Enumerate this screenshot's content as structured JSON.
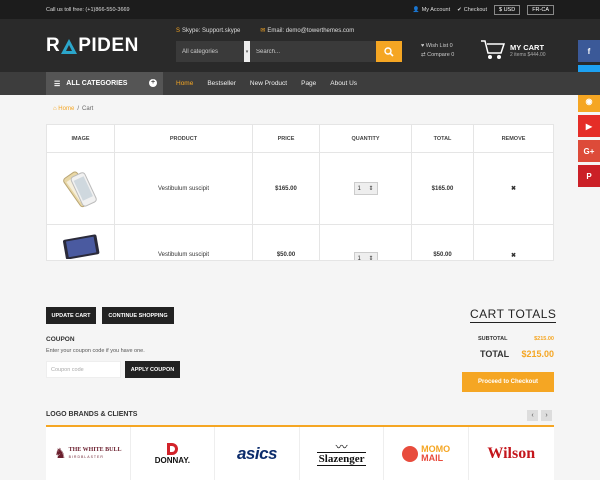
{
  "topbar": {
    "call": "Call us toll free: (+1)866-550-3669",
    "my_account": "My Account",
    "checkout": "Checkout",
    "currency": "$ USD",
    "language": "FR-CA"
  },
  "header": {
    "logo_left": "R",
    "logo_right": "PIDEN",
    "skype": "Skype: Support.skype",
    "email": "Email: demo@towerthemes.com",
    "search_category": "All categories",
    "search_placeholder": "Search...",
    "wish_list": "Wish List 0",
    "compare": "Compare 0",
    "cart_title": "MY CART",
    "cart_summary": "2 items $444.00"
  },
  "nav": {
    "all_categories": "ALL CATEGORIES",
    "links": [
      "Home",
      "Bestseller",
      "New Product",
      "Page",
      "About Us"
    ]
  },
  "breadcrumb": {
    "home": "Home",
    "sep": "/",
    "current": "Cart"
  },
  "table": {
    "headers": [
      "IMAGE",
      "PRODUCT",
      "PRICE",
      "QUANTITY",
      "TOTAL",
      "REMOVE"
    ],
    "rows": [
      {
        "product": "Vestibulum suscipit",
        "price": "$165.00",
        "qty": "1",
        "total": "$165.00",
        "remove": "✖"
      },
      {
        "product": "Vestibulum suscipit",
        "price": "$50.00",
        "qty": "1",
        "total": "$50.00",
        "remove": "✖"
      }
    ]
  },
  "buttons": {
    "update_cart": "UPDATE CART",
    "continue_shopping": "CONTINUE SHOPPING",
    "apply_coupon": "APPLY COUPON",
    "proceed": "Proceed to Checkout"
  },
  "coupon": {
    "title": "COUPON",
    "description": "Enter your coupon code if you have one.",
    "placeholder": "Coupon code"
  },
  "totals": {
    "title": "CART TOTALS",
    "subtotal_label": "SUBTOTAL",
    "subtotal_value": "$215.00",
    "total_label": "TOTAL",
    "total_value": "$215.00"
  },
  "brands": {
    "title": "LOGO BRANDS & CLIENTS",
    "items": [
      {
        "line1": "THE WHITE BULL",
        "line2": "BIRDBLASTER"
      },
      {
        "line1": "DONNAY."
      },
      {
        "line1": "asics"
      },
      {
        "line1": "Slazenger"
      },
      {
        "line1": "MOMO",
        "line2": "MAIL"
      },
      {
        "line1": "Wilson"
      }
    ]
  },
  "social": [
    {
      "name": "facebook",
      "glyph": "f",
      "color": "#3b5998"
    },
    {
      "name": "twitter",
      "glyph": "t",
      "color": "#1da1f2"
    },
    {
      "name": "rss",
      "glyph": "◉",
      "color": "#f5a623"
    },
    {
      "name": "youtube",
      "glyph": "▶",
      "color": "#e52d27"
    },
    {
      "name": "googleplus",
      "glyph": "G+",
      "color": "#dd4b39"
    },
    {
      "name": "pinterest",
      "glyph": "P",
      "color": "#cb2027"
    }
  ],
  "colors": {
    "accent": "#f5a623",
    "dark": "#222222",
    "header": "#2a2a2a"
  }
}
